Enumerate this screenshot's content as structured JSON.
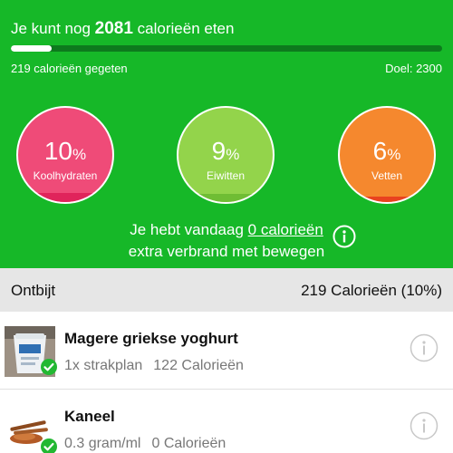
{
  "summary": {
    "remaining_prefix": "Je kunt nog",
    "remaining_value": "2081",
    "remaining_suffix": "calorieën eten",
    "eaten": "219 calorieën gegeten",
    "goal": "Doel: 2300",
    "progress_fraction": 0.095
  },
  "macros": [
    {
      "value": "10",
      "unit": "%",
      "label": "Koolhydraten",
      "fill_fraction": 0.1,
      "color": "#ef4b78"
    },
    {
      "value": "9",
      "unit": "%",
      "label": "Eiwitten",
      "fill_fraction": 0.09,
      "color": "#93d44b"
    },
    {
      "value": "6",
      "unit": "%",
      "label": "Vetten",
      "fill_fraction": 0.06,
      "color": "#f5882e"
    }
  ],
  "burn": {
    "prefix": "Je hebt vandaag",
    "link": "0 calorieën",
    "line2": "extra verbrand met bewegen",
    "icon": "info-icon"
  },
  "meal": {
    "name": "Ontbijt",
    "total": "219 Calorieën (10%)",
    "items": [
      {
        "title": "Magere griekse yoghurt",
        "portion": "1x strakplan",
        "calories": "122 Calorieën",
        "icon": "yoghurt-pot-image"
      },
      {
        "title": "Kaneel",
        "portion": "0.3 gram/ml",
        "calories": "0 Calorieën",
        "icon": "cinnamon-image"
      }
    ]
  },
  "colors": {
    "header_green": "#16b828",
    "check_green": "#22b832",
    "section_grey": "#e6e6e6"
  }
}
